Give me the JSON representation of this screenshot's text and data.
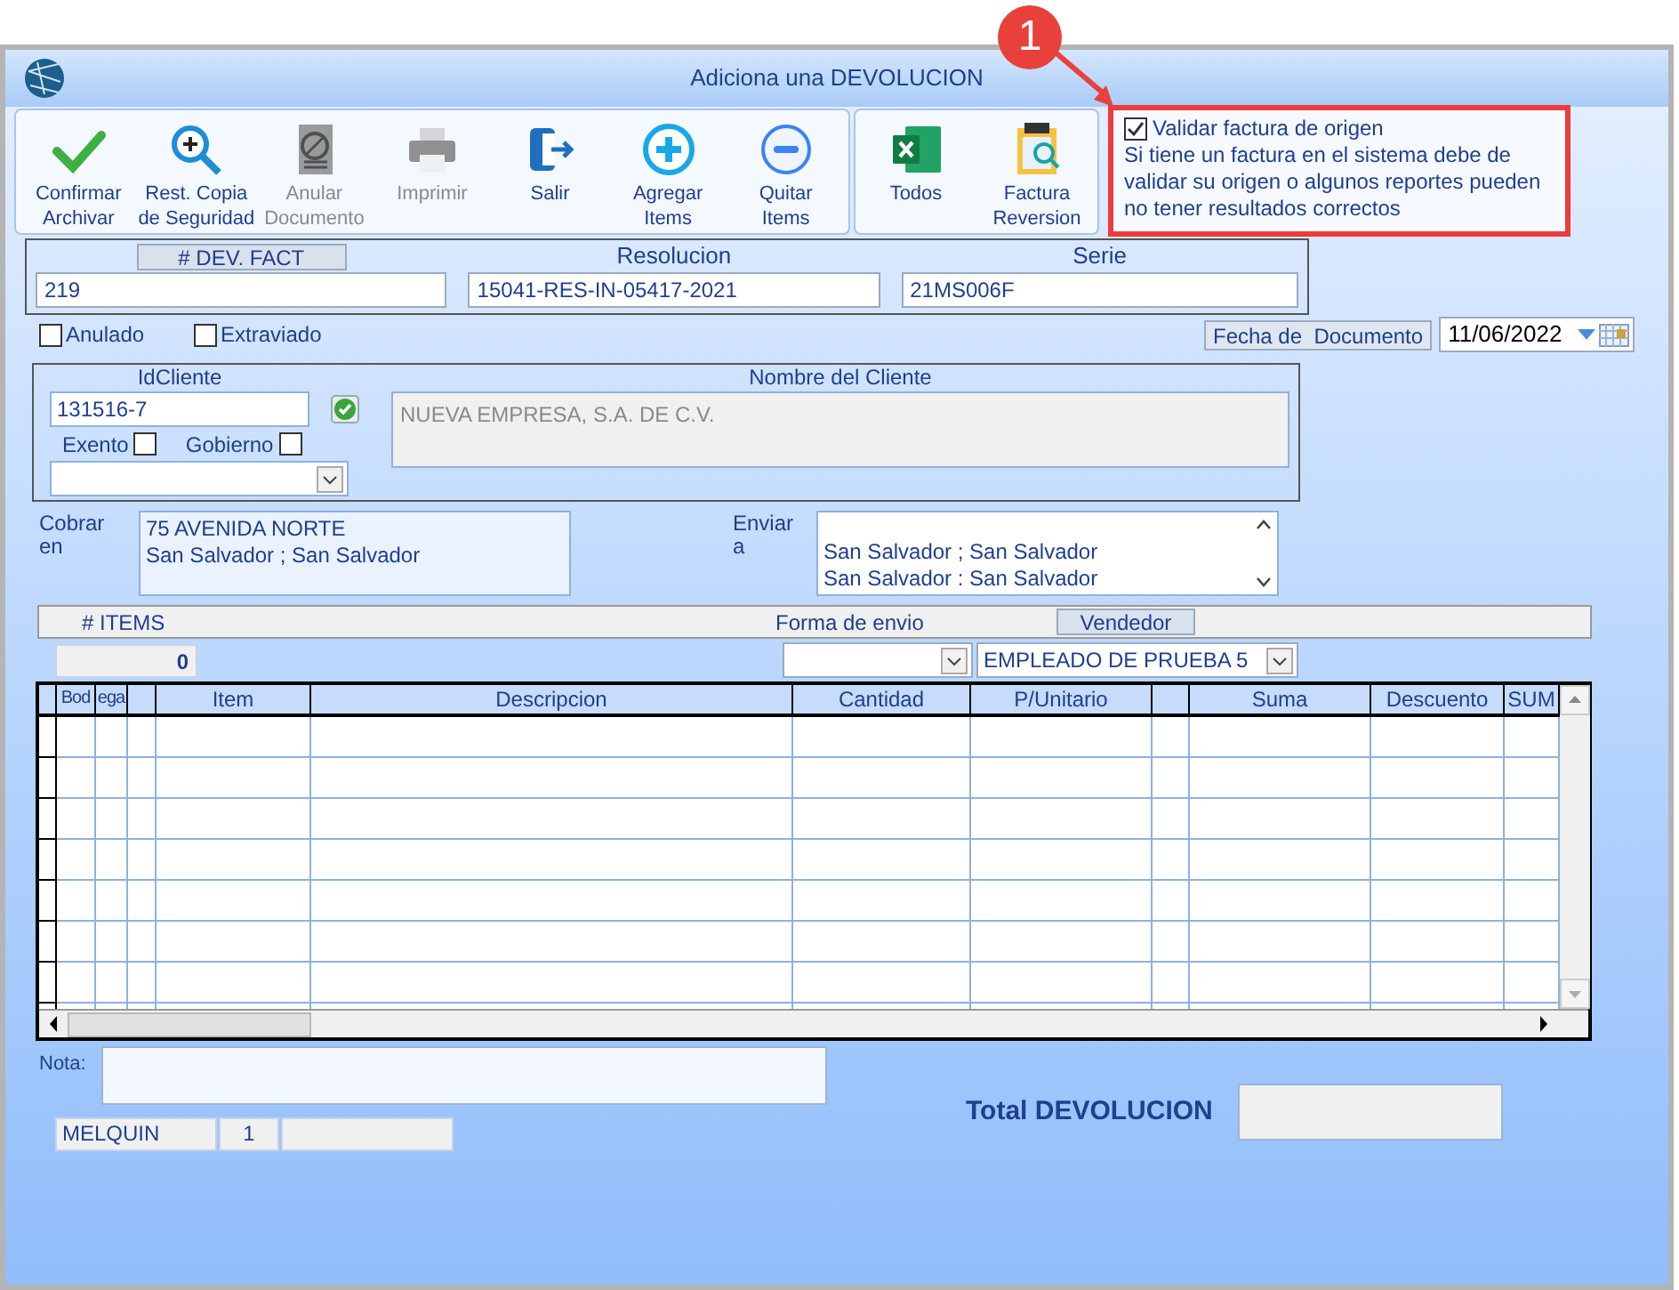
{
  "window": {
    "title": "Adiciona una DEVOLUCION"
  },
  "toolbar": {
    "groups": [
      {
        "buttons": [
          {
            "lines": [
              "Confirmar",
              "Archivar"
            ],
            "disabled": false
          },
          {
            "lines": [
              "Rest. Copia",
              "de Seguridad"
            ],
            "disabled": false
          },
          {
            "lines": [
              "Anular",
              "Documento"
            ],
            "disabled": true
          },
          {
            "lines": [
              "Imprimir"
            ],
            "disabled": true
          },
          {
            "lines": [
              "Salir"
            ],
            "disabled": false
          },
          {
            "lines": [
              "Agregar",
              "Items"
            ],
            "disabled": false
          },
          {
            "lines": [
              "Quitar",
              "Items"
            ],
            "disabled": false
          }
        ]
      },
      {
        "buttons": [
          {
            "lines": [
              "Todos"
            ],
            "disabled": false
          },
          {
            "lines": [
              "Factura",
              "Reversion"
            ],
            "disabled": false
          }
        ]
      }
    ]
  },
  "callout": {
    "badge": "1",
    "checkbox": {
      "label": "Validar factura de origen",
      "checked": true
    },
    "note_lines": [
      "Si tiene un factura en el sistema debe de",
      "validar su origen o algunos reportes pueden",
      "no tener resultados correctos"
    ]
  },
  "document": {
    "fields": [
      {
        "label": "# DEV. FACT",
        "value": "219",
        "kind": "boxed"
      },
      {
        "label": "Resolucion",
        "value": "15041-RES-IN-05417-2021",
        "kind": "plain"
      },
      {
        "label": "Serie",
        "value": "21MS006F",
        "kind": "plain"
      }
    ]
  },
  "flags": [
    {
      "label": "Anulado",
      "checked": false
    },
    {
      "label": "Extraviado",
      "checked": false
    }
  ],
  "date": {
    "label": "Fecha de  Documento",
    "value": "11/06/2022"
  },
  "client": {
    "id_label": "IdCliente",
    "id_value": "131516-7",
    "verified": true,
    "options": [
      {
        "label": "Exento",
        "checked": false
      },
      {
        "label": "Gobierno",
        "checked": false
      }
    ],
    "name_label": "Nombre del Cliente",
    "name_value": "NUEVA EMPRESA, S.A. DE C.V."
  },
  "addresses": [
    {
      "label_lines": [
        "Cobrar",
        "en"
      ],
      "lines": [
        "75 AVENIDA NORTE",
        "San Salvador ; San Salvador"
      ],
      "scrollable": false
    },
    {
      "label_lines": [
        "Enviar",
        "a"
      ],
      "lines": [
        "San Salvador ; San Salvador",
        "San Salvador : San Salvador"
      ],
      "scrollable": true
    }
  ],
  "items_bar": {
    "count_label": "# ITEMS",
    "count": "0",
    "shipping_label": "Forma de envio",
    "seller_label": "Vendedor",
    "seller_value": "EMPLEADO DE PRUEBA 5"
  },
  "grid": {
    "columns": [
      {
        "kind": "text",
        "label": "Bod"
      },
      {
        "kind": "text",
        "label": "ega"
      },
      {
        "kind": "blank"
      },
      {
        "kind": "text",
        "label": "Item"
      },
      {
        "kind": "text",
        "label": "Descripcion"
      },
      {
        "kind": "text",
        "label": "Cantidad"
      },
      {
        "kind": "text",
        "label": "P/Unitario"
      },
      {
        "kind": "blank"
      },
      {
        "kind": "text",
        "label": "Suma"
      },
      {
        "kind": "text",
        "label": "Descuento"
      },
      {
        "kind": "text",
        "label": "SUM"
      }
    ]
  },
  "footer": {
    "note_label": "Nota:",
    "status": [
      "MELQUIN",
      "1"
    ],
    "total_label": "Total DEVOLUCION"
  }
}
